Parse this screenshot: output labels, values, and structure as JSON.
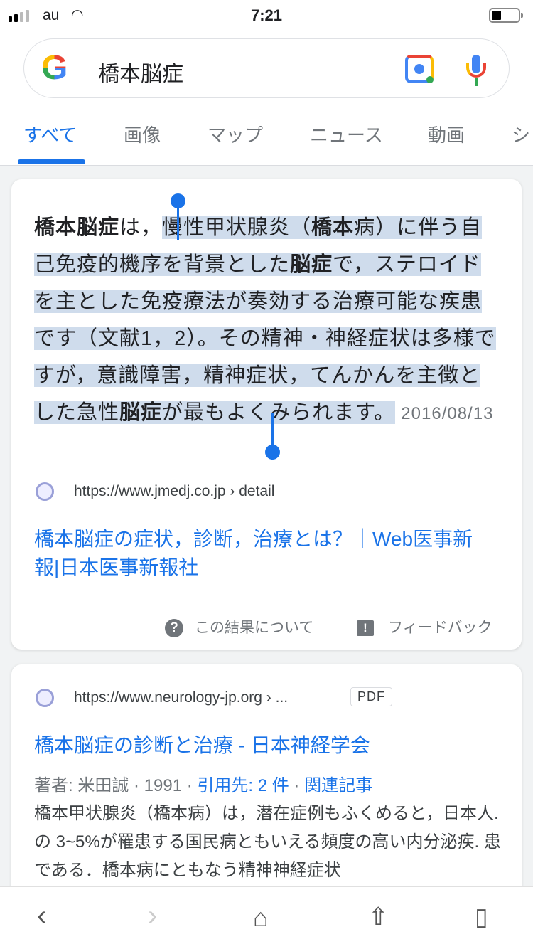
{
  "status": {
    "carrier": "au",
    "time": "7:21"
  },
  "search": {
    "query": "橋本脳症",
    "logo": "G"
  },
  "tabs": [
    "すべて",
    "画像",
    "マップ",
    "ニュース",
    "動画",
    "シ"
  ],
  "result1": {
    "snippet": [
      "橋本脳症",
      "は，",
      "慢性甲状腺炎（",
      "橋本",
      "病）に伴う自己免疫的機序を背景とした",
      "脳症",
      "で，ステロイドを主とした免疫療法が奏効する治療可能な疾患です（文献1，2）。その精神・神経症状は多様ですが，意識障害，精神症状，てんかんを主徴とした急性",
      "脳症",
      "が最もよくみられます。"
    ],
    "date": "2016/08/13",
    "url": "https://www.jmedj.co.jp › detail",
    "title": "橋本脳症の症状，診断，治療とは？｜Web医事新報|日本医事新報社",
    "about": "この結果について",
    "feedback": "フィードバック"
  },
  "result2": {
    "url": "https://www.neurology-jp.org › ...",
    "badge": "PDF",
    "title": "橋本脳症の診断と治療 - 日本神経学会",
    "meta_prefix": "著者: 米田誠 · 1991 · ",
    "cited": "引用先: 2 件",
    "sep": " · ",
    "related": "関連記事",
    "body": "橋本甲状腺炎（橋本病）は，潜在症例もふくめると，日本人. の 3~5%が罹患する国民病ともいえる頻度の高い内分泌疾. 患である．橋本病にともなう精神神経症状"
  },
  "colors": {
    "accent": "#1a73e8",
    "selection": "#cfdcec"
  }
}
